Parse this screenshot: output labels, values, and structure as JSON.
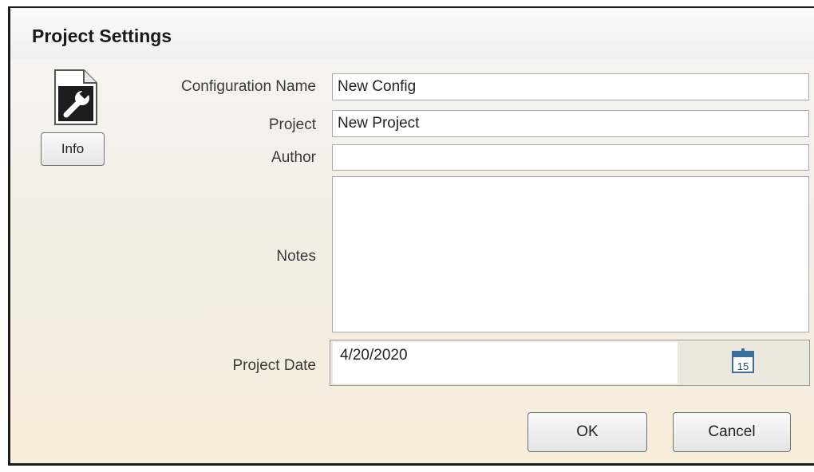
{
  "dialog": {
    "title": "Project Settings"
  },
  "sidebar": {
    "icon": "document-wrench-icon",
    "info_label": "Info"
  },
  "form": {
    "configuration_name": {
      "label": "Configuration Name",
      "value": "New Config"
    },
    "project": {
      "label": "Project",
      "value": "New Project"
    },
    "author": {
      "label": "Author",
      "value": ""
    },
    "notes": {
      "label": "Notes",
      "value": ""
    },
    "project_date": {
      "label": "Project Date",
      "value": "4/20/2020",
      "calendar_day": "15",
      "calendar_icon": "calendar-icon"
    }
  },
  "buttons": {
    "ok": "OK",
    "cancel": "Cancel"
  },
  "colors": {
    "title_text": "#1a1a1a",
    "label_text": "#3a3a3a",
    "field_border": "#a9a9a9",
    "background_bottom": "#f8eedb"
  }
}
